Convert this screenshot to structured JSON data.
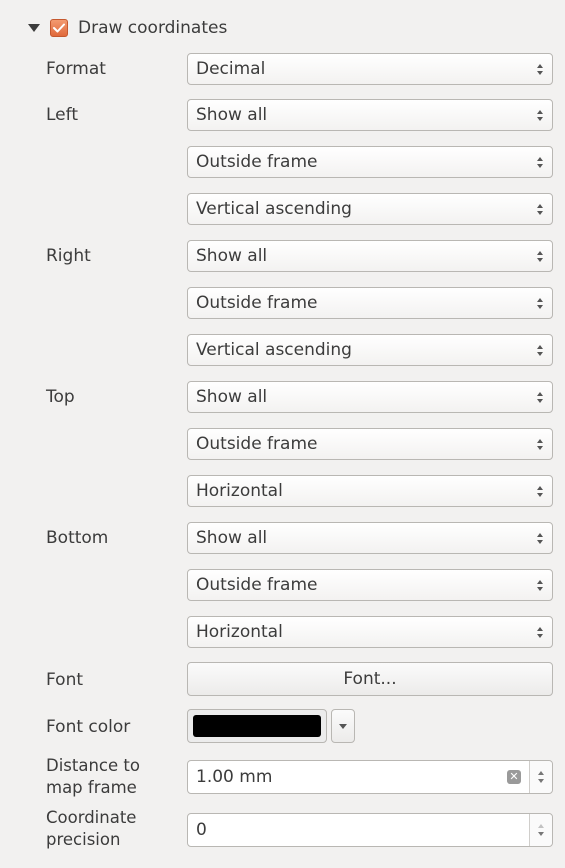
{
  "group": {
    "title": "Draw coordinates",
    "checked": true
  },
  "rows": {
    "format_label": "Format",
    "format_value": "Decimal",
    "left_label": "Left",
    "left_show": "Show all",
    "left_position": "Outside frame",
    "left_direction": "Vertical ascending",
    "right_label": "Right",
    "right_show": "Show all",
    "right_position": "Outside frame",
    "right_direction": "Vertical ascending",
    "top_label": "Top",
    "top_show": "Show all",
    "top_position": "Outside frame",
    "top_direction": "Horizontal",
    "bottom_label": "Bottom",
    "bottom_show": "Show all",
    "bottom_position": "Outside frame",
    "bottom_direction": "Horizontal",
    "font_label": "Font",
    "font_button": "Font...",
    "font_color_label": "Font color",
    "font_color_value": "#000000",
    "distance_label_line1": "Distance to",
    "distance_label_line2": "map frame",
    "distance_value": "1.00 mm",
    "precision_label_line1": "Coordinate",
    "precision_label_line2": "precision",
    "precision_value": "0"
  },
  "icons": {
    "group_arrow": "collapse-arrow-icon",
    "checkbox": "checkmark-icon",
    "clear": "clear-icon"
  },
  "colors": {
    "accent": "#e8774a",
    "swatch": "#000000"
  }
}
